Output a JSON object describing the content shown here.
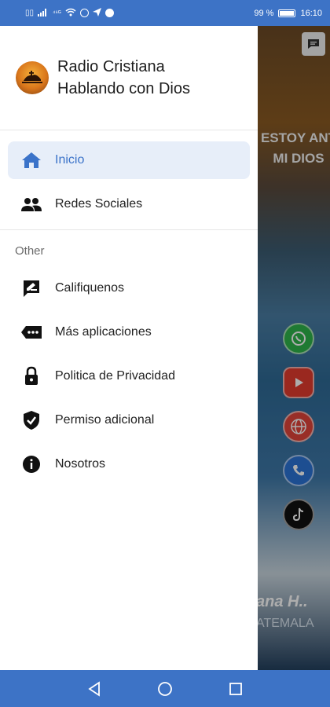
{
  "status_bar": {
    "left_text": "⁴⁶ᴳ",
    "battery": "99 %",
    "time": "16:10",
    "battery_level": 0.99
  },
  "background_app": {
    "heading_line1": "ESTOY ANT",
    "heading_line2": "MI DIOS",
    "station": "ana H..",
    "country": "ATEMALA",
    "icons": [
      "whatsapp-icon",
      "youtube-icon",
      "globe-icon",
      "phone-icon",
      "tiktok-icon"
    ]
  },
  "drawer": {
    "title_line1": "Radio Cristiana",
    "title_line2": "Hablando con Dios",
    "main_items": [
      {
        "label": "Inicio",
        "icon": "home-icon",
        "active": true
      },
      {
        "label": "Redes Sociales",
        "icon": "people-icon",
        "active": false
      }
    ],
    "section_label": "Other",
    "other_items": [
      {
        "label": "Califiquenos",
        "icon": "rate-review-icon"
      },
      {
        "label": "Más aplicaciones",
        "icon": "more-apps-icon"
      },
      {
        "label": "Politica de Privacidad",
        "icon": "lock-icon"
      },
      {
        "label": "Permiso adicional",
        "icon": "shield-check-icon"
      },
      {
        "label": "Nosotros",
        "icon": "info-icon"
      }
    ]
  },
  "colors": {
    "accent": "#3b73c9",
    "active_bg": "#e7eef9",
    "system_bar": "#3d73c6"
  }
}
